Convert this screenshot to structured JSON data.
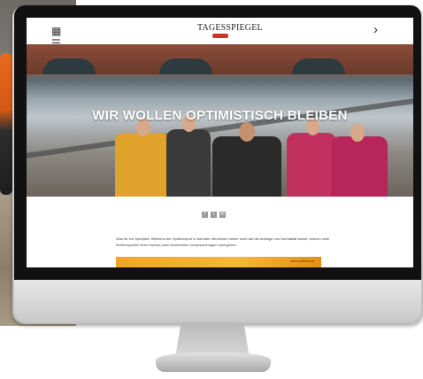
{
  "site": {
    "logo_text": "TAGESSPIEGEL"
  },
  "header": {
    "menu_icon": "grid-menu-icon",
    "next_icon": "chevron-right-icon",
    "next_glyph": "›"
  },
  "hero": {
    "headline": "WIR WOLLEN OPTIMISTISCH BLEIBEN"
  },
  "share": {
    "buttons": [
      {
        "label": "f",
        "icon": "facebook-icon"
      },
      {
        "label": "t",
        "icon": "twitter-icon"
      },
      {
        "label": "✉",
        "icon": "mail-icon"
      }
    ]
  },
  "article": {
    "text": "Was für ein Sportjahr! Während der Spitzensport in fast allen Bereichen immer noch auf die Anfänge von Normalität wartet, können viele Breitensportler ihren Hobbys unter bestimmten Voraussetzungen nachgehen."
  },
  "banner": {
    "text": "www.adidas.de"
  },
  "colors": {
    "logo_accent": "#c0392b",
    "banner": "#f0a52a"
  }
}
